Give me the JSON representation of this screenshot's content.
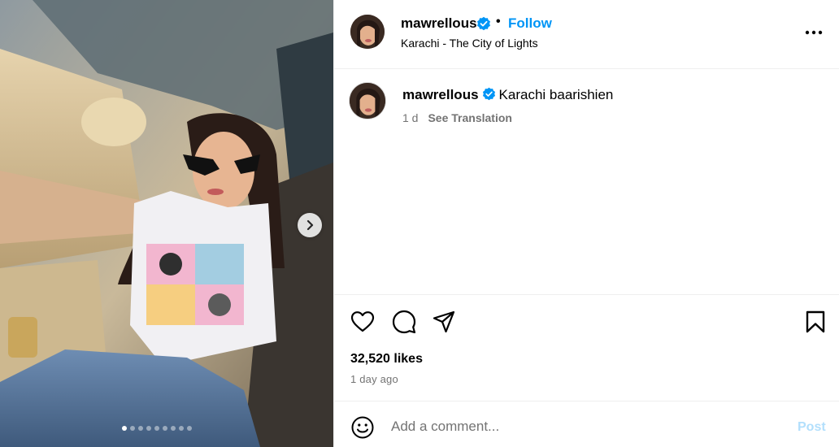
{
  "post": {
    "author": {
      "username": "mawrellous",
      "verified": true,
      "avatar_icon": "profile-avatar",
      "follow_label": "Follow",
      "separator": "•",
      "location": "Karachi - The City of Lights"
    },
    "caption": {
      "username": "mawrellous",
      "text": "Karachi baarishien",
      "age": "1 d",
      "translate_label": "See Translation"
    },
    "media": {
      "description_icon": "photo",
      "carousel_count": 9,
      "carousel_active_index": 0,
      "next_icon": "chevron-right-icon"
    },
    "actions": {
      "like_icon": "heart-icon",
      "comment_icon": "comment-icon",
      "share_icon": "share-icon",
      "save_icon": "bookmark-icon"
    },
    "likes_text": "32,520 likes",
    "time_text": "1 day ago",
    "comment": {
      "placeholder": "Add a comment...",
      "post_label": "Post",
      "emoji_icon": "emoji-icon"
    },
    "colors": {
      "accent": "#0095f6",
      "verified": "#0095f6",
      "post_disabled": "#b2dffc",
      "muted": "#737373"
    }
  }
}
